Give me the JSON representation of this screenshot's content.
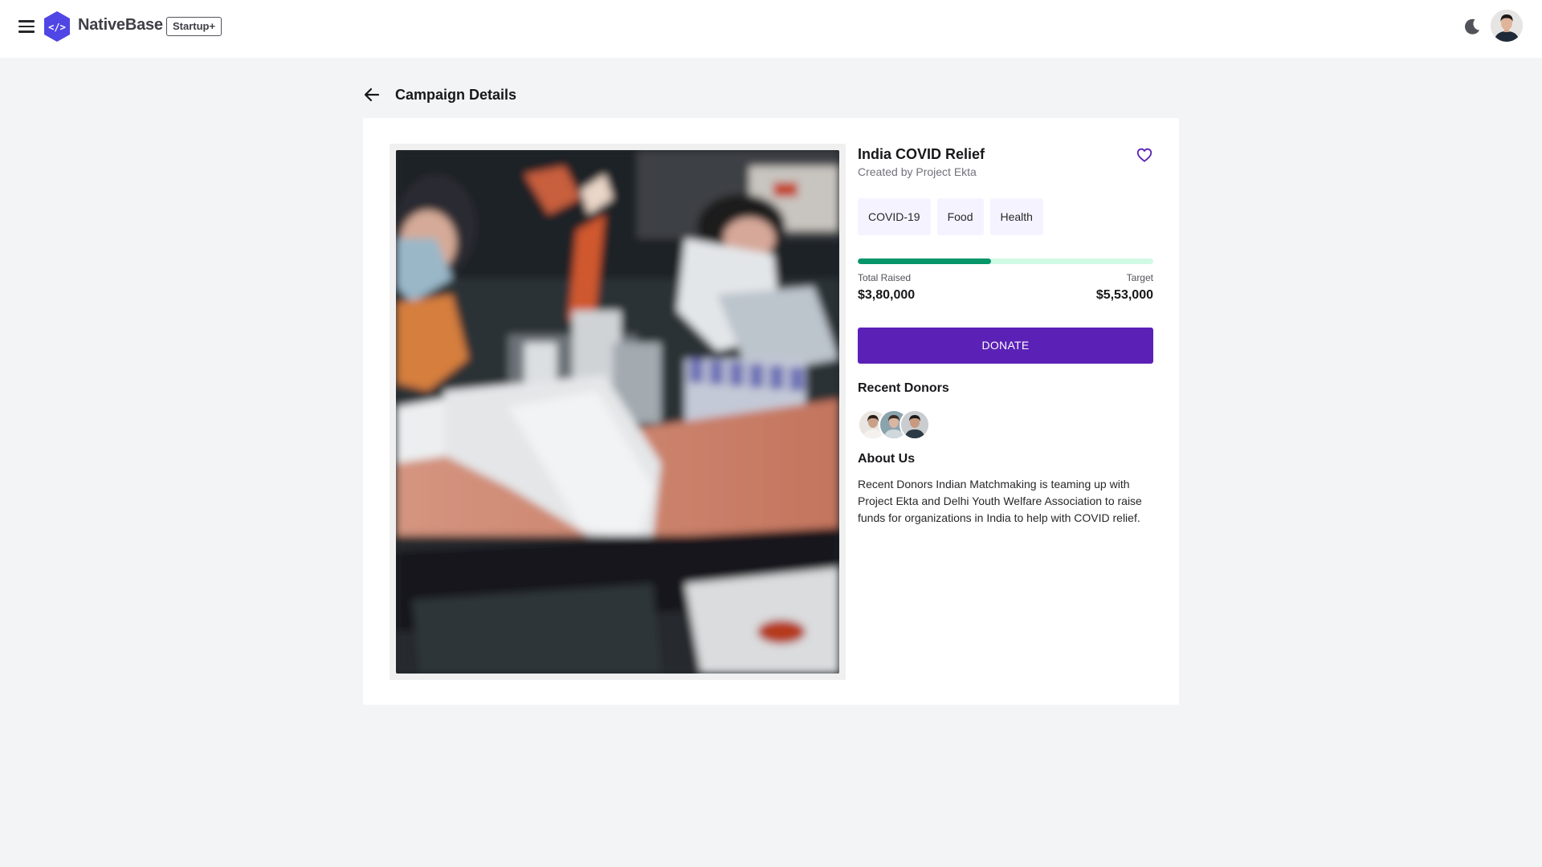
{
  "header": {
    "brand": "NativeBase",
    "plan_badge": "Startup+",
    "icons": [
      "menu-icon",
      "logo-icon",
      "moon-icon",
      "user-avatar"
    ]
  },
  "page": {
    "title": "Campaign Details",
    "back_icon": "arrow-left-icon"
  },
  "campaign": {
    "title": "India COVID Relief",
    "creator": "Created by Project Ekta",
    "favorite_icon": "heart-outline-icon",
    "tags": [
      "COVID-19",
      "Food",
      "Health"
    ],
    "progress": {
      "raised_label": "Total Raised",
      "target_label": "Target",
      "raised_value": "$3,80,000",
      "target_value": "$5,53,000",
      "fraction": 0.45
    },
    "donate_label": "DONATE",
    "donors_heading": "Recent Donors",
    "donor_count_shown": 3,
    "about_heading": "About Us",
    "about_text": "Recent Donors Indian Matchmaking is teaming up with Project Ekta and Delhi Youth Welfare Association to raise funds for organizations in India to help with COVID relief."
  },
  "colors": {
    "accent": "#5b21b6",
    "progress_fill": "#059669",
    "progress_track": "#d1fae5",
    "tag_bg": "#f5f3ff",
    "logo": "#5046e5"
  }
}
